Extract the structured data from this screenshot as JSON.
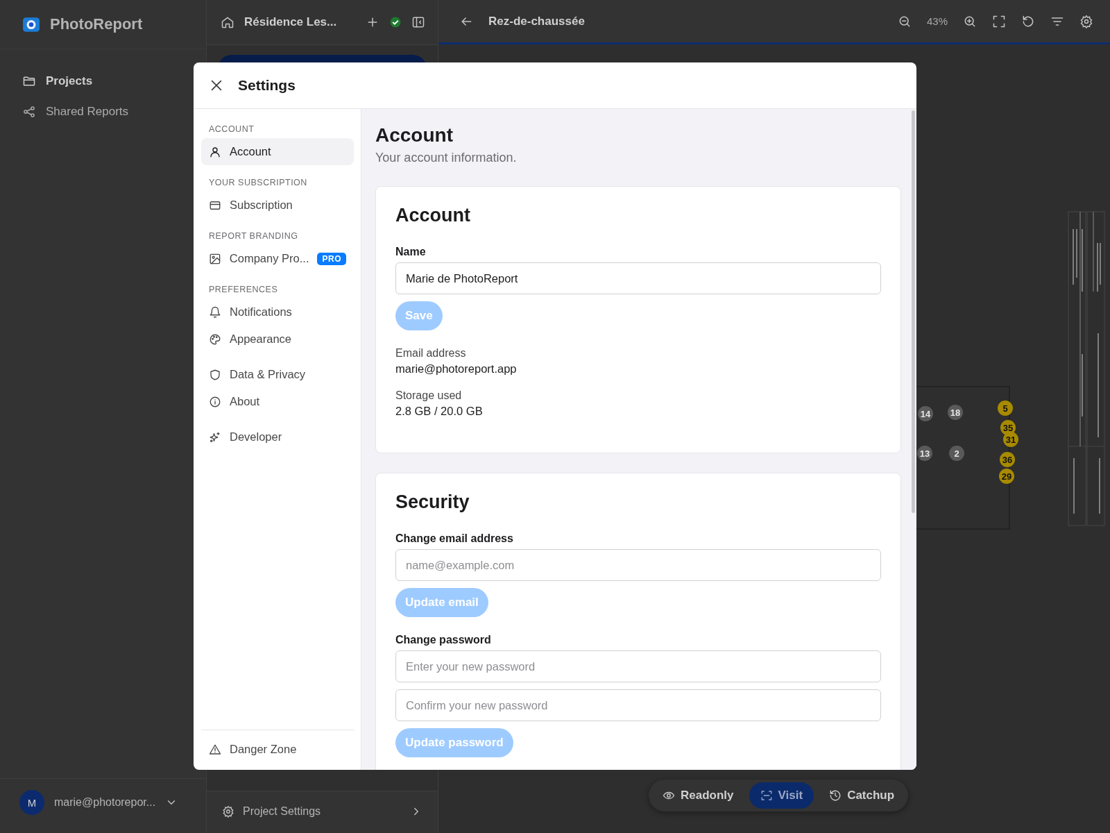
{
  "app": {
    "name": "PhotoReport"
  },
  "nav": [
    {
      "label": "Projects",
      "selected": true
    },
    {
      "label": "Shared Reports",
      "selected": false
    }
  ],
  "user": {
    "avatar": "M",
    "email": "marie@photorepor..."
  },
  "project": {
    "title": "Résidence Les...",
    "settings_label": "Project Settings"
  },
  "plan": {
    "title": "Rez-de-chaussée",
    "zoom": "43%",
    "pins": [
      {
        "label": "14",
        "color": "#5a5a5a"
      },
      {
        "label": "18",
        "color": "#5a5a5a"
      },
      {
        "label": "13",
        "color": "#5a5a5a"
      },
      {
        "label": "2",
        "color": "#5a5a5a"
      },
      {
        "label": "5",
        "color": "#a88a00"
      },
      {
        "label": "35",
        "color": "#a88a00"
      },
      {
        "label": "31",
        "color": "#a88a00"
      },
      {
        "label": "36",
        "color": "#a88a00"
      },
      {
        "label": "29",
        "color": "#a88a00"
      }
    ]
  },
  "modes": [
    {
      "label": "Readonly",
      "selected": false
    },
    {
      "label": "Visit",
      "selected": true
    },
    {
      "label": "Catchup",
      "selected": false
    }
  ],
  "settings": {
    "title": "Settings",
    "sections": [
      {
        "heading": "ACCOUNT",
        "items": [
          {
            "label": "Account",
            "selected": true
          }
        ]
      },
      {
        "heading": "YOUR SUBSCRIPTION",
        "items": [
          {
            "label": "Subscription",
            "selected": false
          }
        ]
      },
      {
        "heading": "REPORT BRANDING",
        "items": [
          {
            "label": "Company Pro...",
            "badge": "PRO",
            "selected": false
          }
        ]
      },
      {
        "heading": "PREFERENCES",
        "items": [
          {
            "label": "Notifications",
            "selected": false
          },
          {
            "label": "Appearance",
            "selected": false
          }
        ]
      },
      {
        "items": [
          {
            "label": "Data & Privacy",
            "selected": false
          },
          {
            "label": "About",
            "selected": false
          }
        ]
      },
      {
        "items": [
          {
            "label": "Developer",
            "selected": false
          }
        ]
      }
    ],
    "danger": {
      "label": "Danger Zone",
      "selected": false
    },
    "page_title": "Account",
    "page_subtitle": "Your account information.",
    "cards": [
      {
        "title": "Account",
        "blocks": [
          {
            "kind": "field",
            "label": "Name",
            "value": "Marie de PhotoReport"
          },
          {
            "kind": "button",
            "label": "Save",
            "disabled": true
          },
          {
            "kind": "info",
            "label": "Email address",
            "value": "marie@photoreport.app"
          },
          {
            "kind": "info",
            "label": "Storage used",
            "value": "2.8 GB / 20.0 GB"
          }
        ]
      },
      {
        "title": "Security",
        "blocks": [
          {
            "kind": "field",
            "label": "Change email address",
            "placeholder": "name@example.com"
          },
          {
            "kind": "button",
            "label": "Update email",
            "disabled": true
          },
          {
            "kind": "field",
            "label": "Change password",
            "placeholder": "Enter your new password"
          },
          {
            "kind": "field",
            "placeholder": "Confirm your new password"
          },
          {
            "kind": "button",
            "label": "Update password",
            "disabled": true
          }
        ]
      }
    ]
  }
}
